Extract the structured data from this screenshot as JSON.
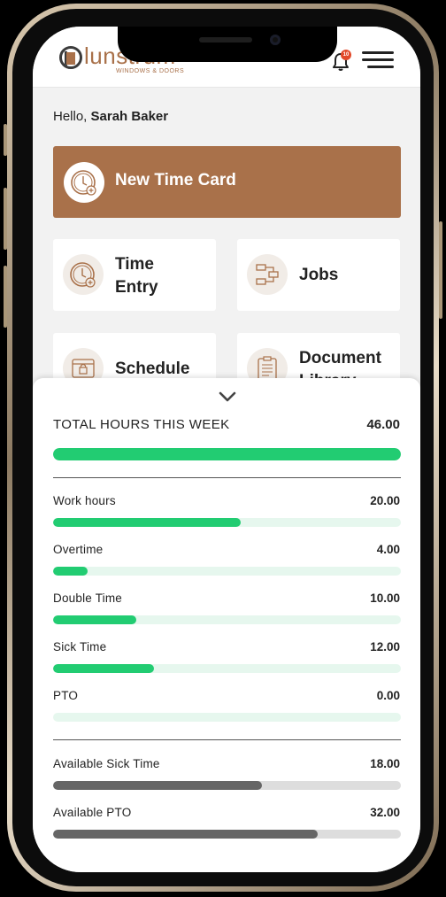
{
  "header": {
    "logo_word": "lunstrum",
    "logo_sub": "WINDOWS & DOORS",
    "notification_count": "10"
  },
  "greeting": {
    "prefix": "Hello, ",
    "name": "Sarah Baker"
  },
  "new_time_card": {
    "label": "New Time Card",
    "icon": "clock-plus-icon"
  },
  "tiles": [
    {
      "label_line1": "Time",
      "label_line2": "Entry",
      "icon": "clock-plus-icon"
    },
    {
      "label_line1": "Jobs",
      "icon": "flowchart-icon"
    },
    {
      "label_line1": "Schedule",
      "icon": "calendar-lock-icon"
    },
    {
      "label_line1": "Document",
      "label_line2": "Library",
      "icon": "clipboard-icon"
    }
  ],
  "summary": {
    "total_label": "TOTAL HOURS THIS WEEK",
    "total_value": "46.00",
    "total_fill": 1.0,
    "rows": [
      {
        "label": "Work hours",
        "value": "20.00",
        "fill": 0.54
      },
      {
        "label": "Overtime",
        "value": "4.00",
        "fill": 0.1
      },
      {
        "label": "Double Time",
        "value": "10.00",
        "fill": 0.24
      },
      {
        "label": "Sick Time",
        "value": "12.00",
        "fill": 0.29
      },
      {
        "label": "PTO",
        "value": "0.00",
        "fill": 0.0
      }
    ],
    "available": [
      {
        "label": "Available Sick Time",
        "value": "18.00",
        "fill": 0.6
      },
      {
        "label": "Available PTO",
        "value": "32.00",
        "fill": 0.76
      }
    ]
  },
  "colors": {
    "brand": "#a9714a",
    "green": "#22cc72",
    "green_track": "#e6f7ee",
    "gray_fill": "#666666",
    "gray_track": "#dddddd"
  }
}
